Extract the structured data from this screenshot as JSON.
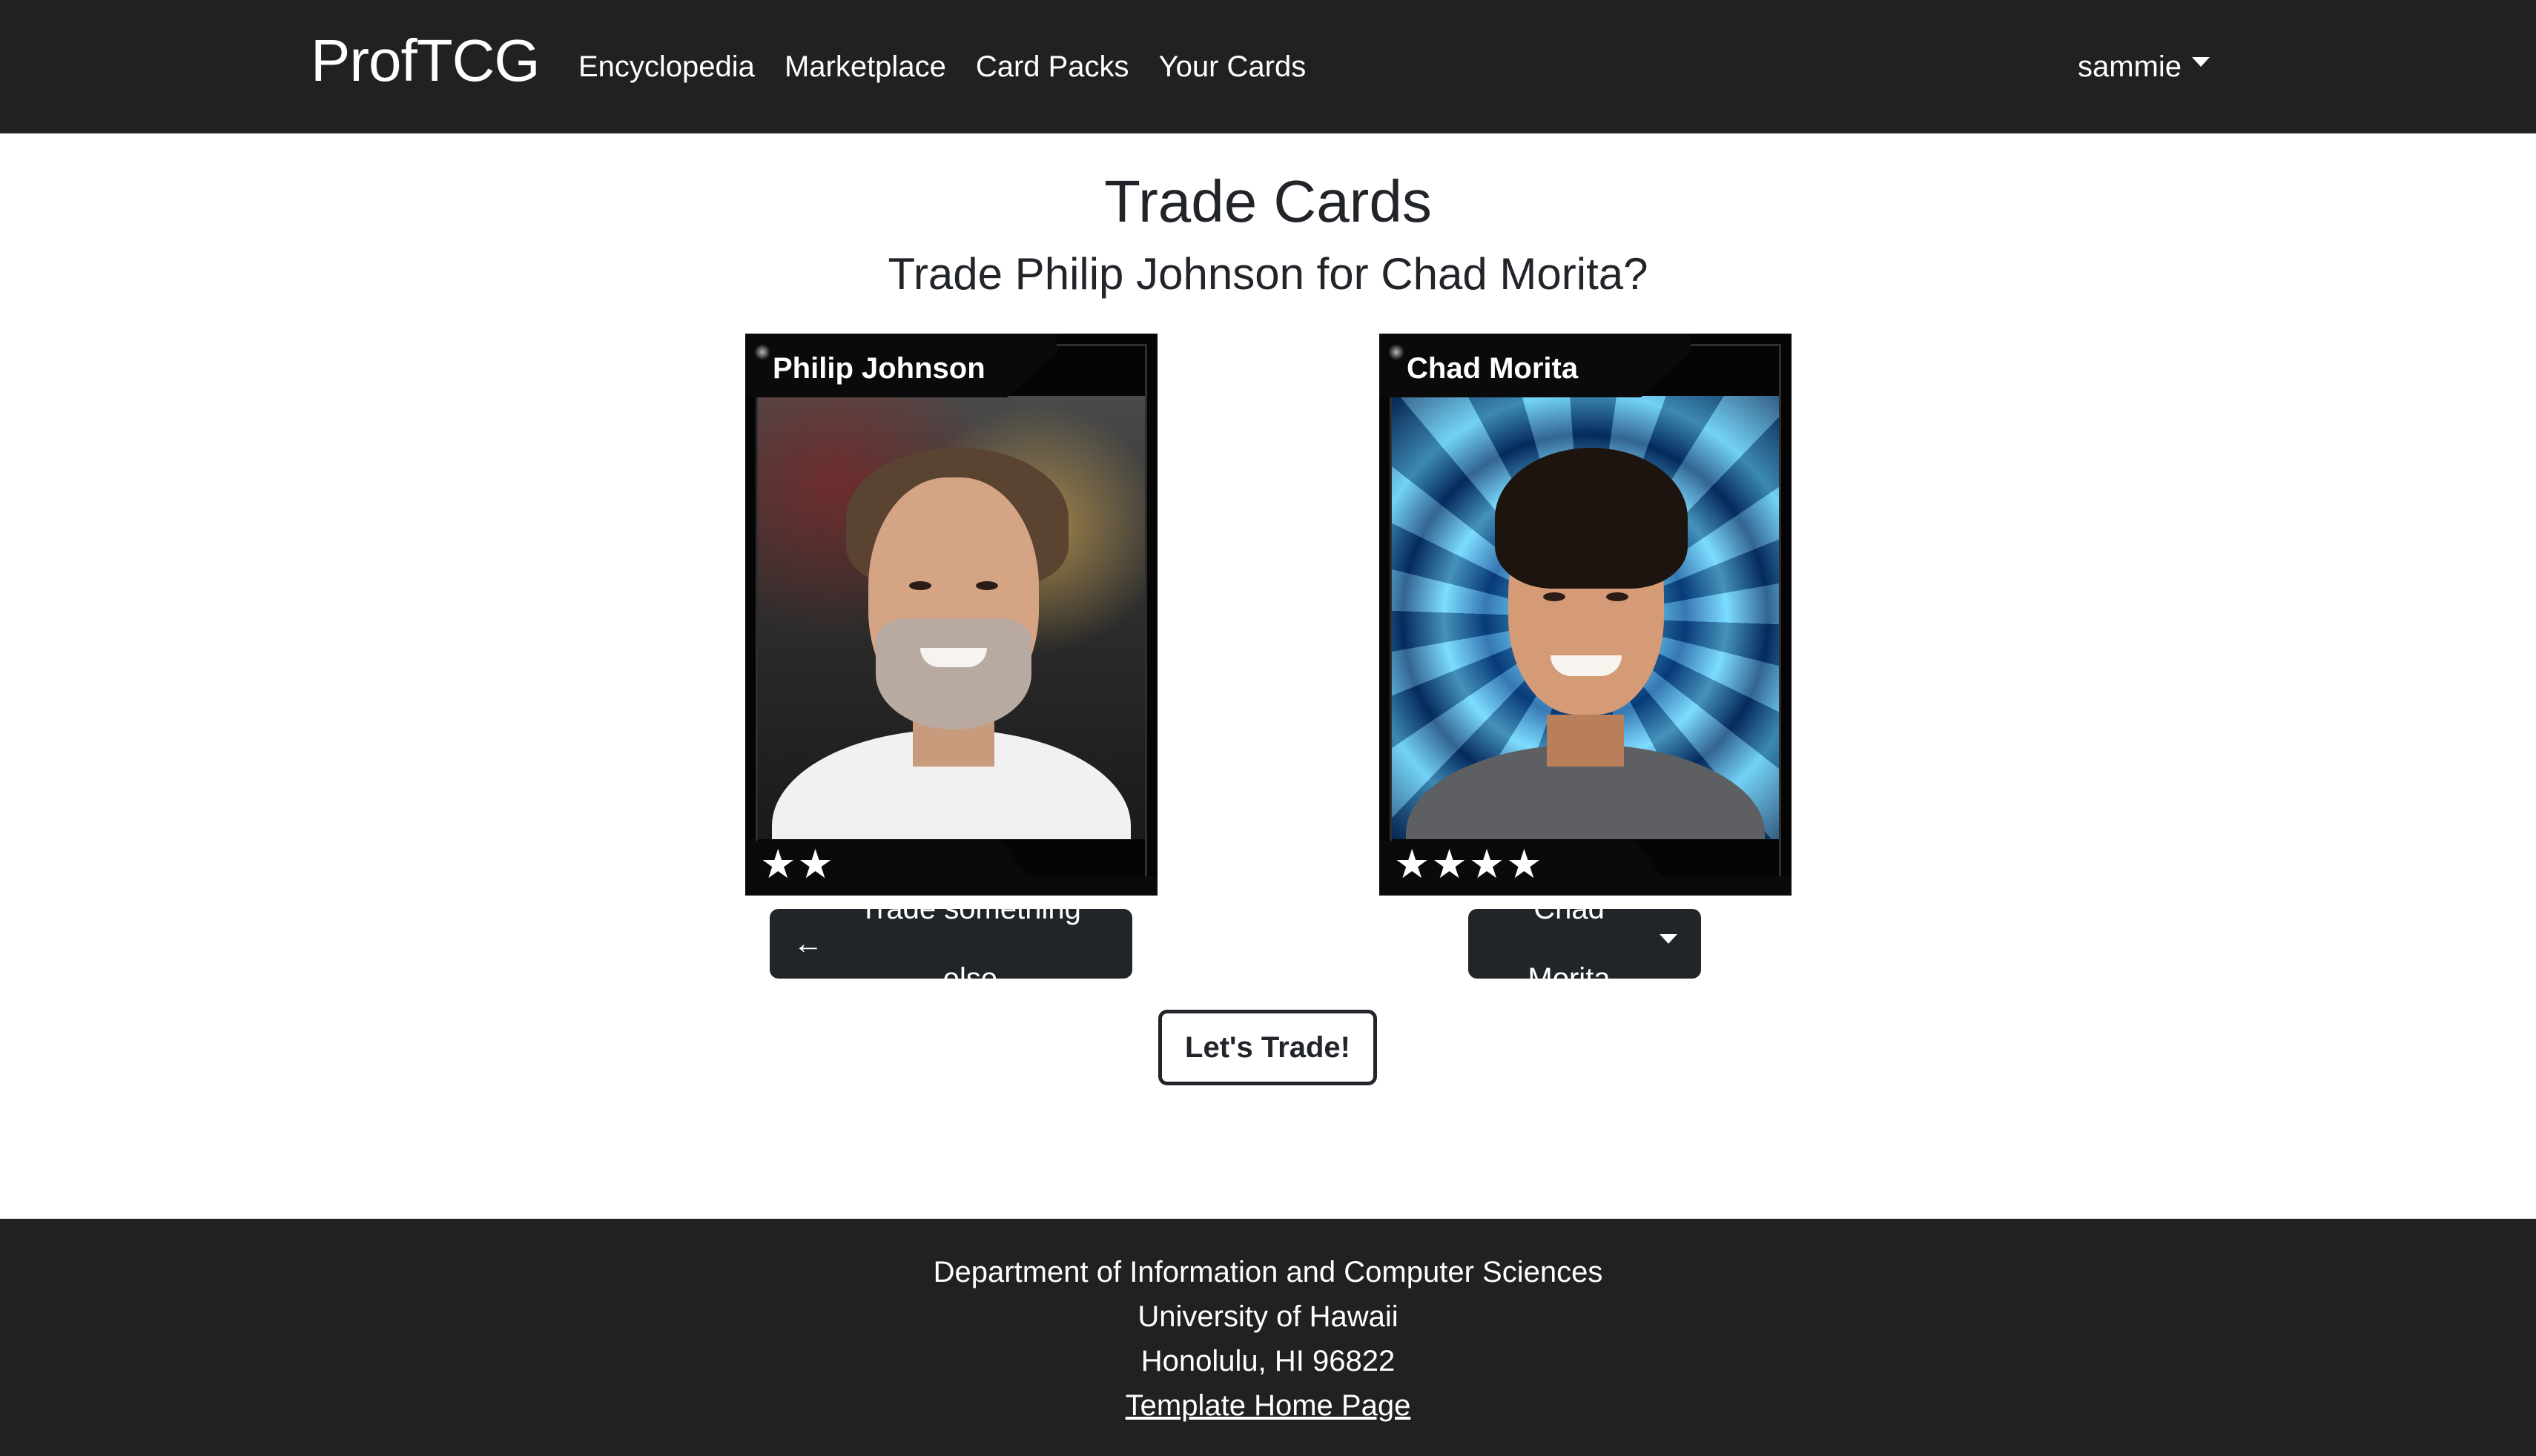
{
  "navbar": {
    "brand": "ProfTCG",
    "links": [
      "Encyclopedia",
      "Marketplace",
      "Card Packs",
      "Your Cards"
    ],
    "user": "sammie"
  },
  "page": {
    "title": "Trade Cards",
    "subtitle": "Trade Philip Johnson for Chad Morita?"
  },
  "cards": [
    {
      "name": "Philip Johnson",
      "stars": "★★",
      "rating": 2
    },
    {
      "name": "Chad Morita",
      "stars": "★★★★",
      "rating": 4
    }
  ],
  "buttons": {
    "back_arrow": "←",
    "back_label": "Trade something else",
    "select_label": "Chad Morita",
    "trade_label": "Let's Trade!"
  },
  "footer": {
    "line1": "Department of Information and Computer Sciences",
    "line2": "University of Hawaii",
    "line3": "Honolulu, HI 96822",
    "link": "Template Home Page"
  },
  "colors": {
    "navbar_bg": "#212121",
    "button_dark": "#212529",
    "text": "#212529"
  }
}
